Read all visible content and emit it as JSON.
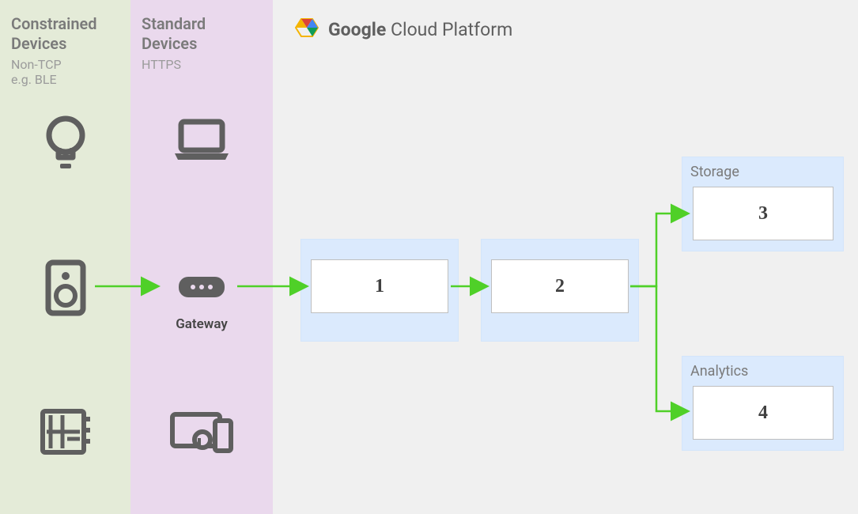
{
  "columns": {
    "constrained": {
      "title1": "Constrained",
      "title2": "Devices",
      "sub1": "Non-TCP",
      "sub2": "e.g. BLE"
    },
    "standard": {
      "title1": "Standard",
      "title2": "Devices",
      "sub1": "HTTPS",
      "gateway_label": "Gateway"
    }
  },
  "platform": {
    "brand_bold": "Google",
    "brand_rest": " Cloud Platform"
  },
  "nodes": {
    "box1": "1",
    "box2": "2",
    "storage_label": "Storage",
    "box3": "3",
    "analytics_label": "Analytics",
    "box4": "4"
  },
  "icons": {
    "lightbulb": "lightbulb-icon",
    "speaker": "speaker-icon",
    "panel": "circuit-board-icon",
    "laptop": "laptop-icon",
    "gateway": "gateway-hub-icon",
    "multidevice": "multi-device-icon",
    "gcp": "gcp-logo-icon"
  },
  "chart_data": {
    "type": "diagram",
    "title": "Google Cloud Platform IoT Architecture",
    "lanes": [
      {
        "name": "Constrained Devices",
        "protocol": "Non-TCP e.g. BLE",
        "items": [
          "lightbulb",
          "speaker",
          "circuit-board"
        ]
      },
      {
        "name": "Standard Devices",
        "protocol": "HTTPS",
        "items": [
          "laptop",
          "gateway",
          "multi-device"
        ]
      },
      {
        "name": "Google Cloud Platform",
        "items": [
          "1",
          "2",
          "Storage/3",
          "Analytics/4"
        ]
      }
    ],
    "edges": [
      [
        "Constrained Devices",
        "Standard Devices"
      ],
      [
        "Standard Devices",
        "1"
      ],
      [
        "1",
        "2"
      ],
      [
        "2",
        "Storage/3"
      ],
      [
        "2",
        "Analytics/4"
      ]
    ]
  }
}
